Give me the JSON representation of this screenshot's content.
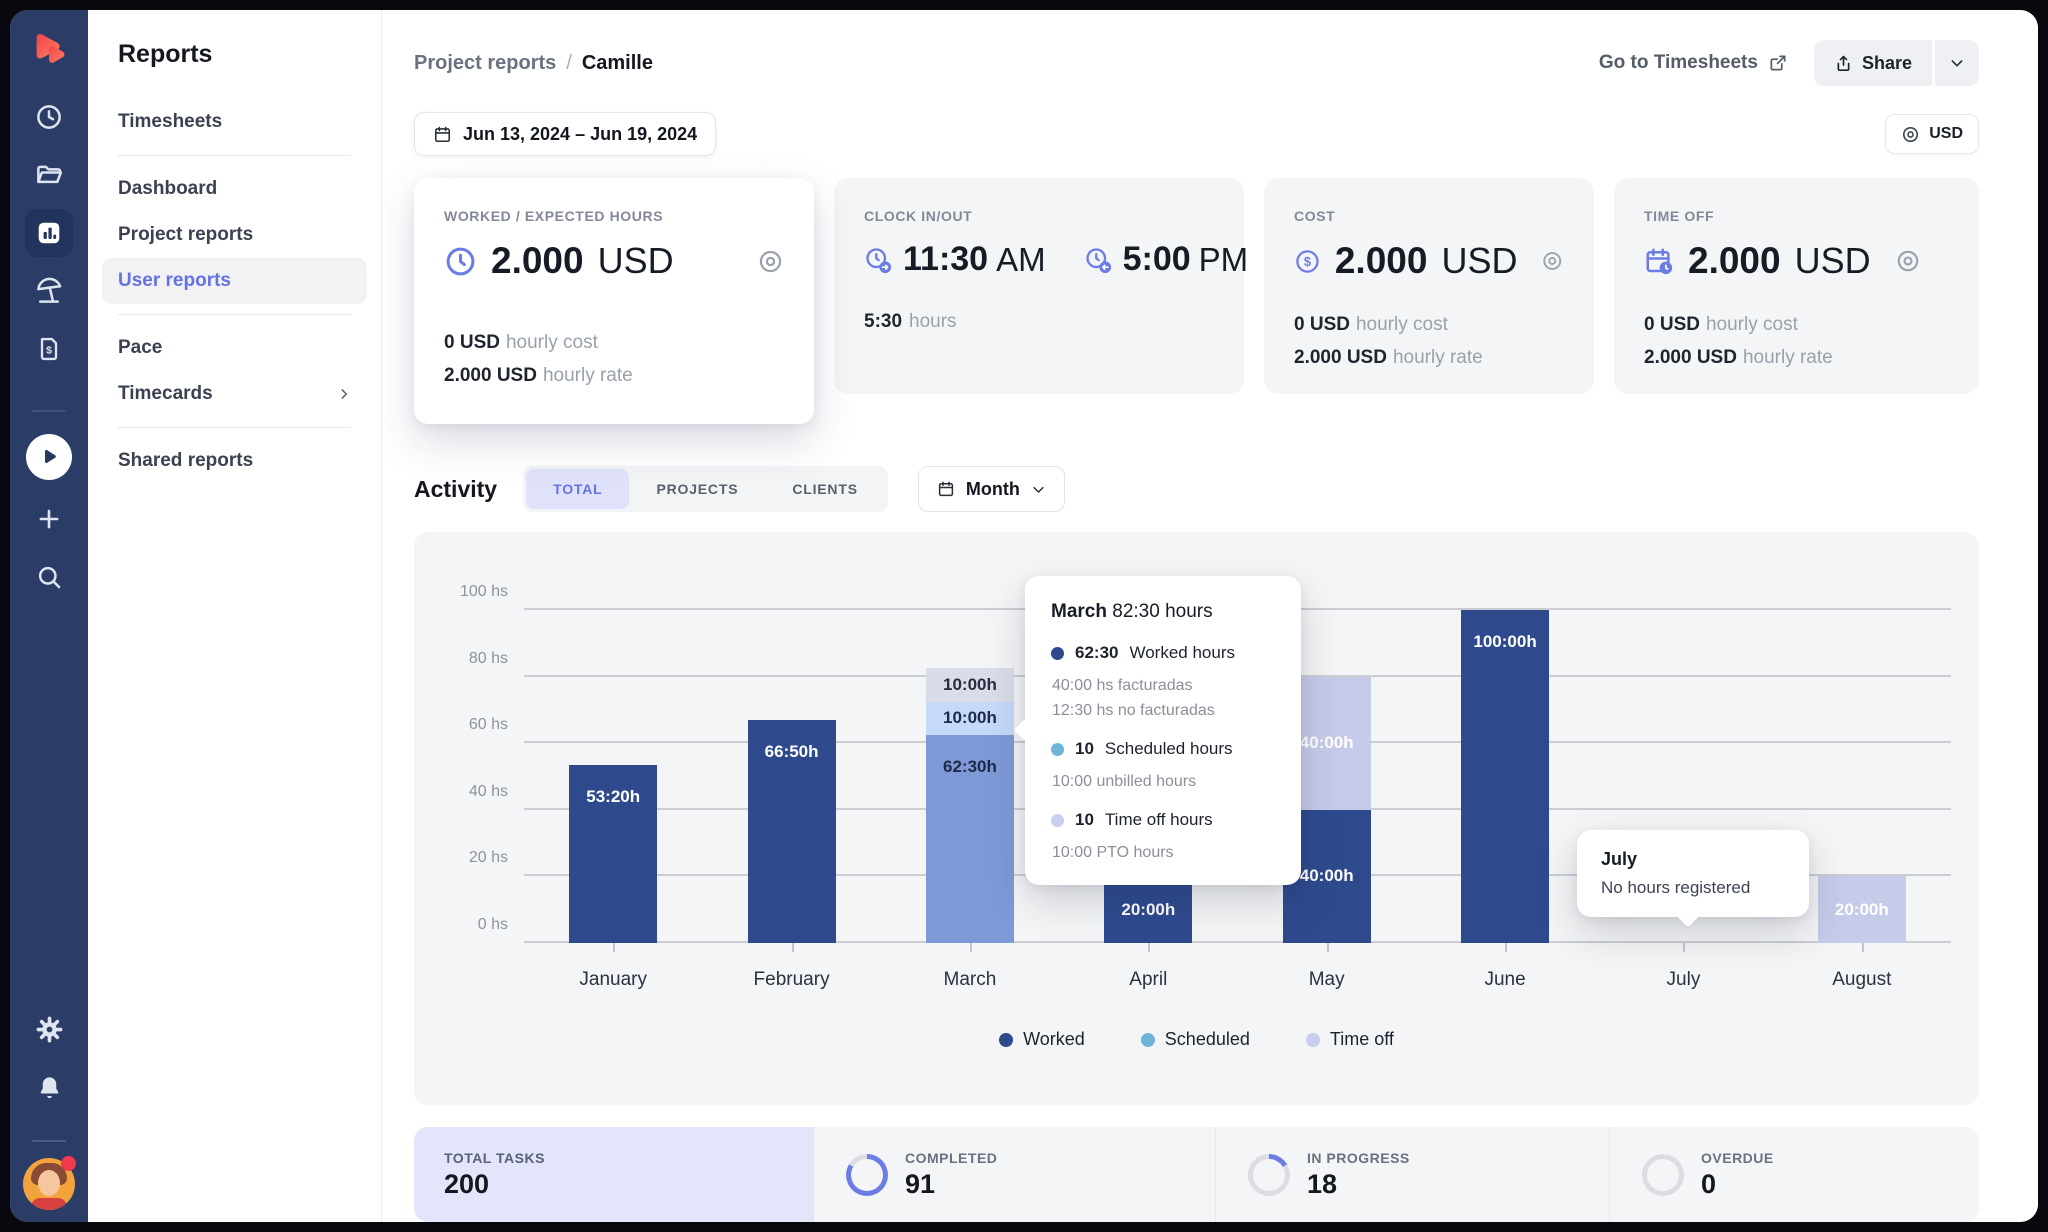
{
  "sidebar": {
    "title": "Reports",
    "items": [
      {
        "label": "Timesheets"
      },
      {
        "label": "Dashboard"
      },
      {
        "label": "Project reports"
      },
      {
        "label": "User reports",
        "active": true
      },
      {
        "label": "Pace"
      },
      {
        "label": "Timecards",
        "chevron": true
      },
      {
        "label": "Shared reports"
      }
    ]
  },
  "header": {
    "breadcrumb": {
      "parent": "Project reports",
      "separator": "/",
      "current": "Camille"
    },
    "go_to_timesheets": "Go to Timesheets",
    "share": "Share"
  },
  "filters": {
    "date_range": "Jun 13, 2024 – Jun 19, 2024",
    "currency": "USD"
  },
  "cards": {
    "worked": {
      "title": "WORKED / EXPECTED HOURS",
      "value": "2.000",
      "unit": "USD",
      "rows": [
        {
          "value": "0 USD",
          "label": "hourly cost"
        },
        {
          "value": "2.000 USD",
          "label": "hourly rate"
        }
      ]
    },
    "clock": {
      "title": "CLOCK IN/OUT",
      "in_value": "11:30",
      "in_unit": "AM",
      "out_value": "5:00",
      "out_unit": "PM",
      "hours_value": "5:30",
      "hours_label": "hours"
    },
    "cost": {
      "title": "COST",
      "value": "2.000",
      "unit": "USD",
      "rows": [
        {
          "value": "0 USD",
          "label": "hourly cost"
        },
        {
          "value": "2.000 USD",
          "label": "hourly rate"
        }
      ]
    },
    "timeoff": {
      "title": "TIME OFF",
      "value": "2.000",
      "unit": "USD",
      "rows": [
        {
          "value": "0 USD",
          "label": "hourly cost"
        },
        {
          "value": "2.000 USD",
          "label": "hourly rate"
        }
      ]
    }
  },
  "activity": {
    "title": "Activity",
    "tabs": [
      {
        "label": "TOTAL",
        "active": true
      },
      {
        "label": "PROJECTS"
      },
      {
        "label": "CLIENTS"
      }
    ],
    "period": "Month"
  },
  "chart_data": {
    "type": "bar",
    "stacked": true,
    "unit": "hours",
    "grid": true,
    "y_axis": {
      "ticks": [
        0,
        20,
        40,
        60,
        80,
        100
      ],
      "suffix": " hs",
      "max": 100
    },
    "categories": [
      "January",
      "February",
      "March",
      "April",
      "May",
      "June",
      "July",
      "August"
    ],
    "hovered_index": 2,
    "series": [
      {
        "name": "Worked",
        "legend_color": "#2E4A8D",
        "bar_color": "#2E4A8D",
        "label_color": "#FFFFFF",
        "hover_bar_color": "#7F99D7",
        "hover_label_color": "#1E2A47",
        "values": [
          53.33,
          66.83,
          62.5,
          20,
          40,
          100,
          0,
          0
        ],
        "labels": [
          "53:20h",
          "66:50h",
          "62:30h",
          "20:00h",
          "40:00h",
          "100:00h",
          "",
          ""
        ]
      },
      {
        "name": "Scheduled",
        "legend_color": "#6FB5D9",
        "bar_color": "#C5D9F8",
        "label_color": "#1E2A47",
        "hover_bar_color": "#C5D9F8",
        "hover_label_color": "#1E2A47",
        "values": [
          0,
          0,
          10,
          0,
          0,
          0,
          0,
          0
        ],
        "labels": [
          "",
          "",
          "10:00h",
          "",
          "",
          "",
          "",
          ""
        ]
      },
      {
        "name": "Time off",
        "legend_color": "#C9CDF0",
        "bar_color": "#C5CBE9",
        "label_color": "#FFFFFF",
        "hover_bar_color": "#DADCE9",
        "hover_label_color": "#272D3E",
        "values": [
          0,
          0,
          10,
          0,
          40,
          0,
          0,
          20
        ],
        "labels": [
          "",
          "",
          "10:00h",
          "",
          "40:00h",
          "",
          "",
          "20:00h"
        ]
      }
    ]
  },
  "legend": [
    {
      "label": "Worked",
      "color": "#2E4A8D"
    },
    {
      "label": "Scheduled",
      "color": "#6FB5D9"
    },
    {
      "label": "Time off",
      "color": "#C9CDF0"
    }
  ],
  "tooltips": {
    "march": {
      "title_bold": "March",
      "title_rest": "82:30 hours",
      "rows": [
        {
          "dot": "#2E4A8D",
          "value": "62:30",
          "label": "Worked hours",
          "sub1": "40:00 hs facturadas",
          "sub2": "12:30 hs no facturadas"
        },
        {
          "dot": "#6FB5D9",
          "value": "10",
          "label": "Scheduled hours",
          "sub1": "10:00 unbilled hours"
        },
        {
          "dot": "#C9CDF0",
          "value": "10",
          "label": "Time off hours",
          "sub1": "10:00 PTO hours"
        }
      ]
    },
    "july": {
      "title": "July",
      "text": "No hours registered"
    }
  },
  "stats": [
    {
      "label": "TOTAL TASKS",
      "value": "200",
      "highlight": true,
      "ring_percent": null
    },
    {
      "label": "COMPLETED",
      "value": "91",
      "ring_percent": 83.5
    },
    {
      "label": "IN PROGRESS",
      "value": "18",
      "ring_percent": 16.5
    },
    {
      "label": "OVERDUE",
      "value": "0",
      "ring_percent": 0
    }
  ],
  "colors": {
    "rail_bg": "#2B3D66",
    "accent_purple": "#6473E4",
    "bar_navy": "#2E4A8D",
    "ring_blue": "#6B7CE5",
    "ring_gray": "#DBDDE2",
    "panel_gray": "#F4F5F6",
    "highlight_lavender": "#E3E5FB"
  }
}
